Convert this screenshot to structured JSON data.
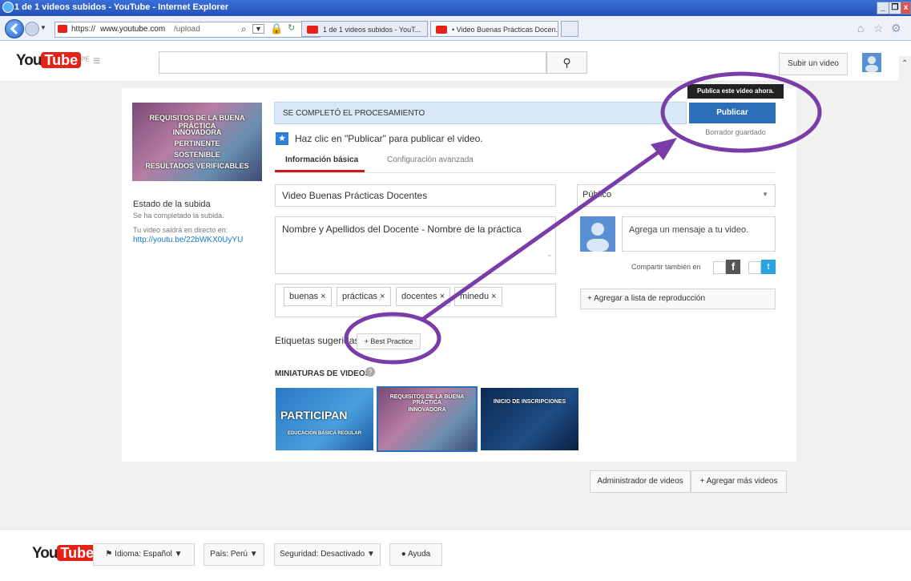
{
  "browser": {
    "title": "1 de 1 videos subidos - YouTube - Internet Explorer",
    "url_prefix": "https://",
    "url_domain": "www.youtube.com",
    "url_path": "/upload",
    "tabs": [
      "1 de 1 videos subidos - YouT...",
      "• Video Buenas Prácticas Docen..."
    ],
    "window_controls": [
      "_",
      "❐",
      "x"
    ]
  },
  "header": {
    "logo_you": "You",
    "logo_tube": "Tube",
    "country": "PE",
    "search_placeholder": "",
    "upload_button": "Subir un video"
  },
  "upload": {
    "thumbnail_text": [
      "REQUISITOS DE LA BUENA PRÁCTICA",
      "INNOVADORA",
      "PERTINENTE",
      "SOSTENIBLE",
      "RESULTADOS VERIFICABLES"
    ],
    "status_title": "Estado de la subida",
    "status_text": "Se ha completado la subida.",
    "live_text": "Tu video saldrá en directo en:",
    "video_link": "http://youtu.be/22bWKX0UyYU",
    "processing": "SE COMPLETÓ EL PROCESAMIENTO",
    "hint": "Haz clic en \"Publicar\" para publicar el video.",
    "tab_basic": "Información básica",
    "tab_advanced": "Configuración avanzada",
    "title_value": "Video  Buenas Prácticas Docentes",
    "description_value": "Nombre y Apellidos del Docente - Nombre de la práctica",
    "tags": [
      "buenas",
      "prácticas",
      "docentes",
      "minedu"
    ],
    "suggested_label": "Etiquetas sugeridas:",
    "suggested_tag": "+ Best Practice",
    "thumbnails_label": "MINIATURAS DE VIDEOS",
    "thumb1_title": "PARTICIPAN",
    "thumb1_sub": "EDUCACIÓN BÁSICA REGULAR",
    "thumb3_title": "INICIO DE INSCRIPCIONES",
    "privacy": "Público",
    "message_placeholder": "Agrega un mensaje a tu video.",
    "share_label": "Compartir también en",
    "playlist_button": "+ Agregar a lista de reproducción",
    "tooltip": "Publica este video ahora.",
    "publish_button": "Publicar",
    "draft_saved": "Borrador guardado"
  },
  "bottom_buttons": {
    "manager": "Administrador de videos",
    "add_more": "+  Agregar más videos"
  },
  "footer": {
    "language": "Idioma: Español",
    "country": "País: Perú",
    "safety": "Seguridad: Desactivado",
    "help": "Ayuda"
  },
  "colors": {
    "annotation": "#7a3da7",
    "publish_blue": "#2c6eb8",
    "youtube_red": "#e62117"
  }
}
